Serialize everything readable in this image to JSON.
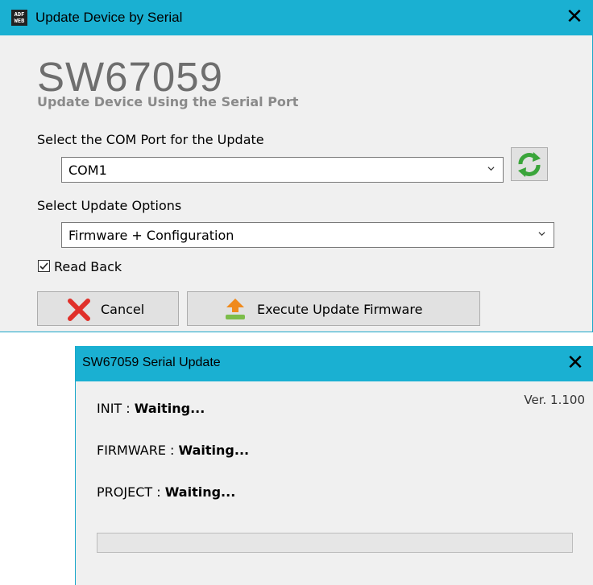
{
  "update_window": {
    "title": "Update Device by Serial",
    "app_icon_text": "ADF WEB",
    "heading": "SW67059",
    "subheading": "Update Device Using the Serial Port",
    "com_port_label": "Select the COM Port for the Update",
    "com_port_value": "COM1",
    "options_label": "Select Update Options",
    "options_value": "Firmware + Configuration",
    "read_back_label": "Read Back",
    "read_back_checked": true,
    "cancel_label": "Cancel",
    "execute_label": "Execute Update Firmware"
  },
  "serial_update_window": {
    "title": "SW67059 Serial Update",
    "version": "Ver. 1.100",
    "init_label": "INIT : ",
    "init_status": "Waiting...",
    "firmware_label": "FIRMWARE : ",
    "firmware_status": "Waiting...",
    "project_label": "PROJECT : ",
    "project_status": "Waiting...",
    "progress": 0
  },
  "colors": {
    "titlebar": "#1ab0d2",
    "heading_gray": "#6e6e6e"
  }
}
